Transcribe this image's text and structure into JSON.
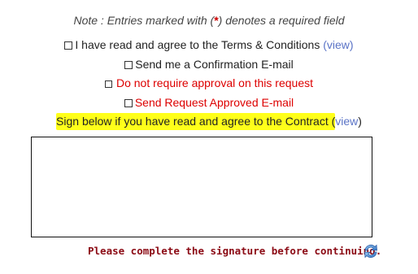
{
  "note": {
    "prefix": "Note : Entries marked with (",
    "star": "*",
    "suffix": ") denotes a required field"
  },
  "options": [
    {
      "label": "I have read and agree to the Terms & Conditions",
      "link": "(view)",
      "checked": false
    },
    {
      "label": "Send me a Confirmation E-mail",
      "checked": false
    },
    {
      "label": "Do not require approval on this request",
      "checked": false
    },
    {
      "label": "Send Request Approved E-mail",
      "checked": false
    }
  ],
  "signature": {
    "instruction_highlighted": "Sign below if you have read and agree to the Contract (",
    "instruction_link": "view",
    "instruction_end": ")",
    "error_message": "Please complete the signature before continuing.",
    "refresh_icon": "refresh-icon"
  },
  "colors": {
    "highlight": "#ffff1a",
    "link": "#5a73c6",
    "error": "#8b0a14",
    "red_option": "#dd0000"
  }
}
